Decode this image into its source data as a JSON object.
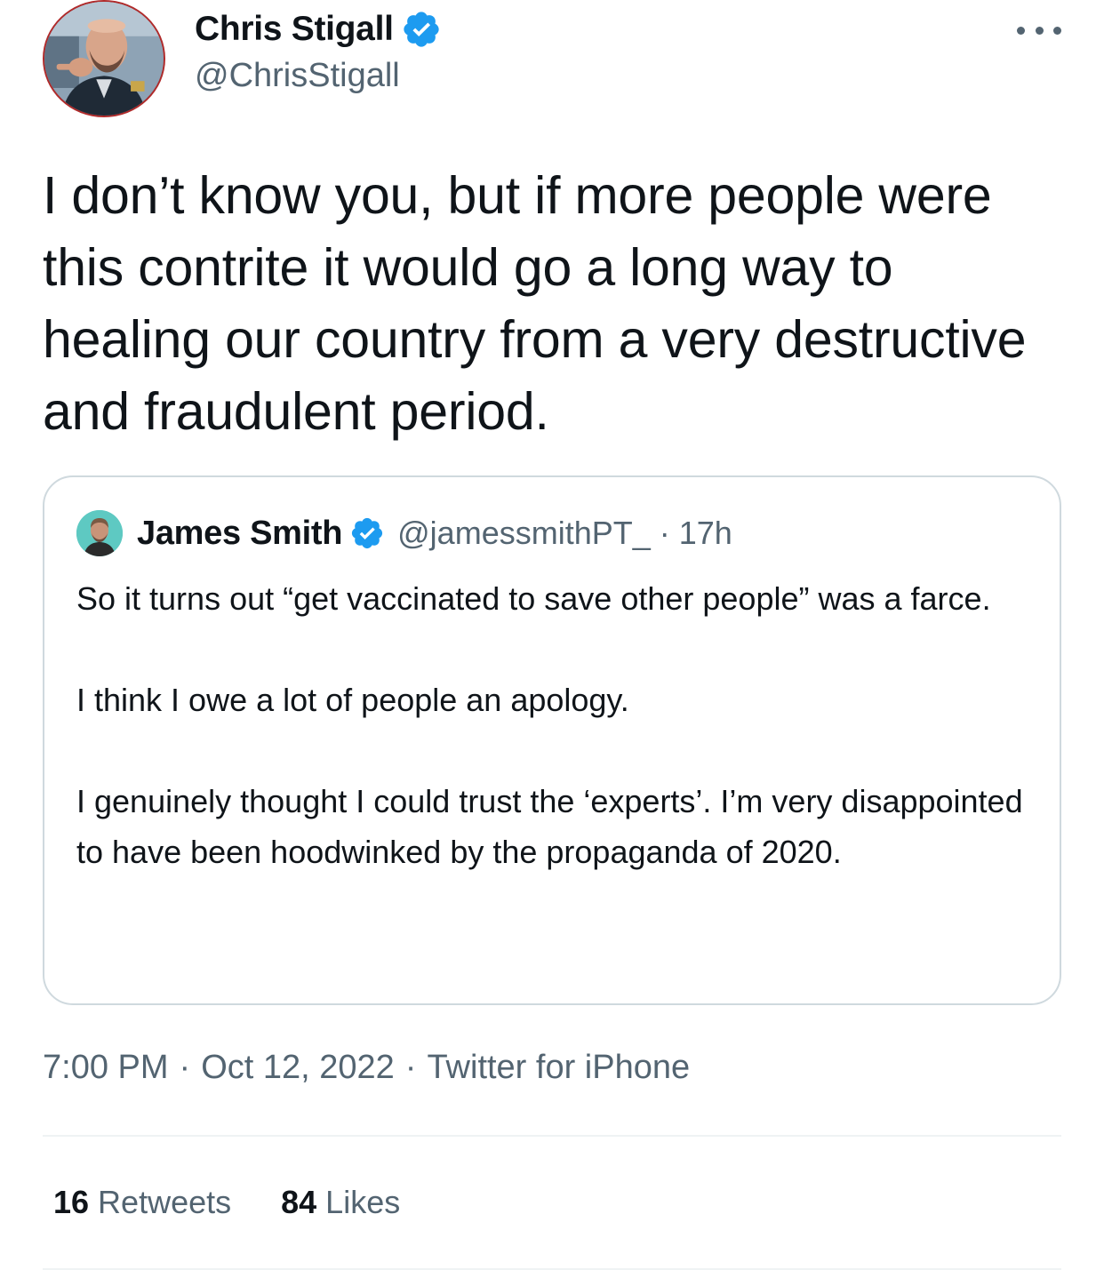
{
  "author": {
    "name": "Chris Stigall",
    "handle": "@ChrisStigall",
    "verified": true
  },
  "tweet_text": "I don’t know you, but if more people were this contrite it would go a long way to healing our country from a very destructive and fraudulent period.",
  "quoted_tweet": {
    "name": "James Smith",
    "handle": "@jamessmithPT_",
    "separator": "·",
    "time": "17h",
    "verified": true,
    "paragraphs": [
      "So it turns out “get vaccinated to save other people” was a farce.",
      "I think I owe a lot of people an apology.",
      "I genuinely thought I could trust the ‘experts’. I’m very disappointed to have been hoodwinked by the propaganda of 2020."
    ]
  },
  "meta": {
    "time": "7:00 PM",
    "separator": "·",
    "date": "Oct 12, 2022",
    "source": "Twitter for iPhone"
  },
  "stats": {
    "retweets_count": "16",
    "retweets_label": "Retweets",
    "likes_count": "84",
    "likes_label": "Likes"
  },
  "icons": {
    "verified": "verified-badge-icon",
    "more": "more-options-icon"
  },
  "colors": {
    "verified_blue": "#1d9bf0",
    "text_primary": "#0f1419",
    "text_secondary": "#536471",
    "border": "#cfd9de"
  }
}
